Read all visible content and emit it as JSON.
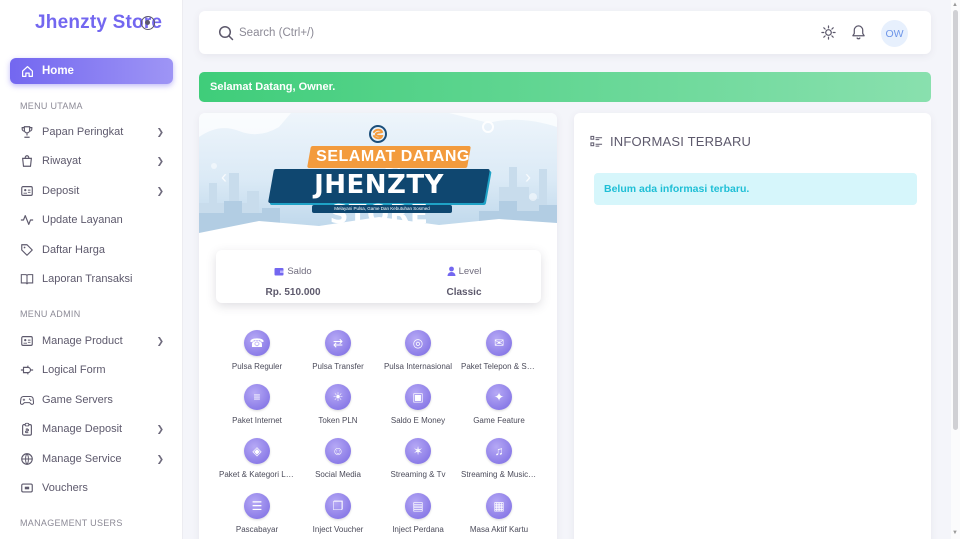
{
  "brand": {
    "title": "Jhenzty Store"
  },
  "sidebar": {
    "home": "Home",
    "sections": {
      "main": "MENU UTAMA",
      "admin": "MENU ADMIN",
      "users": "MANAGEMENT USERS"
    },
    "main_items": [
      {
        "label": "Papan Peringkat",
        "icon": "trophy-icon",
        "chevron": true
      },
      {
        "label": "Riwayat",
        "icon": "shopping-bag-icon",
        "chevron": true
      },
      {
        "label": "Deposit",
        "icon": "id-card-icon",
        "chevron": true
      },
      {
        "label": "Update Layanan",
        "icon": "activity-icon",
        "chevron": false
      },
      {
        "label": "Daftar Harga",
        "icon": "tag-icon",
        "chevron": false
      },
      {
        "label": "Laporan Transaksi",
        "icon": "book-icon",
        "chevron": false
      }
    ],
    "admin_items": [
      {
        "label": "Manage Product",
        "icon": "id-card-icon",
        "chevron": true
      },
      {
        "label": "Logical Form",
        "icon": "plug-icon",
        "chevron": false
      },
      {
        "label": "Game Servers",
        "icon": "gamepad-icon",
        "chevron": false
      },
      {
        "label": "Manage Deposit",
        "icon": "clipboard-icon",
        "chevron": true
      },
      {
        "label": "Manage Service",
        "icon": "globe-icon",
        "chevron": true
      },
      {
        "label": "Vouchers",
        "icon": "ticket-icon",
        "chevron": false
      }
    ]
  },
  "search": {
    "placeholder": "Search (Ctrl+/)"
  },
  "user": {
    "initials": "OW"
  },
  "welcome": {
    "text": "Selamat Datang, Owner."
  },
  "hero": {
    "line1": "SELAMAT DATANG DI",
    "line2": "JHENZTY STORE",
    "line3": "Melayani Pulsa, Game Dan Kebutuhan Sosmed"
  },
  "balance": {
    "saldo_label": "Saldo",
    "saldo_value": "Rp. 510.000",
    "level_label": "Level",
    "level_value": "Classic"
  },
  "services": [
    {
      "name": "Pulsa Reguler",
      "icon": "phone-icon"
    },
    {
      "name": "Pulsa Transfer",
      "icon": "phone-transfer-icon"
    },
    {
      "name": "Pulsa Internasional",
      "icon": "globe-icon"
    },
    {
      "name": "Paket Telepon & SMS",
      "icon": "sms-icon"
    },
    {
      "name": "Paket Internet",
      "icon": "internet-icon"
    },
    {
      "name": "Token PLN",
      "icon": "bulb-icon"
    },
    {
      "name": "Saldo E Money",
      "icon": "wallet-icon"
    },
    {
      "name": "Game Feature",
      "icon": "controller-icon"
    },
    {
      "name": "Paket & Kategori Lai...",
      "icon": "ticket-icon"
    },
    {
      "name": "Social Media",
      "icon": "social-icon"
    },
    {
      "name": "Streaming & Tv",
      "icon": "satellite-icon"
    },
    {
      "name": "Streaming & Music ...",
      "icon": "music-icon"
    },
    {
      "name": "Pascabayar",
      "icon": "receipt-icon"
    },
    {
      "name": "Inject Voucher",
      "icon": "voucher-icon"
    },
    {
      "name": "Inject Perdana",
      "icon": "sim-card-icon"
    },
    {
      "name": "Masa Aktif Kartu",
      "icon": "calendar-icon"
    }
  ],
  "info": {
    "title": "INFORMASI TERBARU",
    "empty_text": "Belum ada informasi terbaru."
  },
  "colors": {
    "primary": "#7367f0",
    "success": "#3fcd7a",
    "info": "#1fbfd6"
  }
}
